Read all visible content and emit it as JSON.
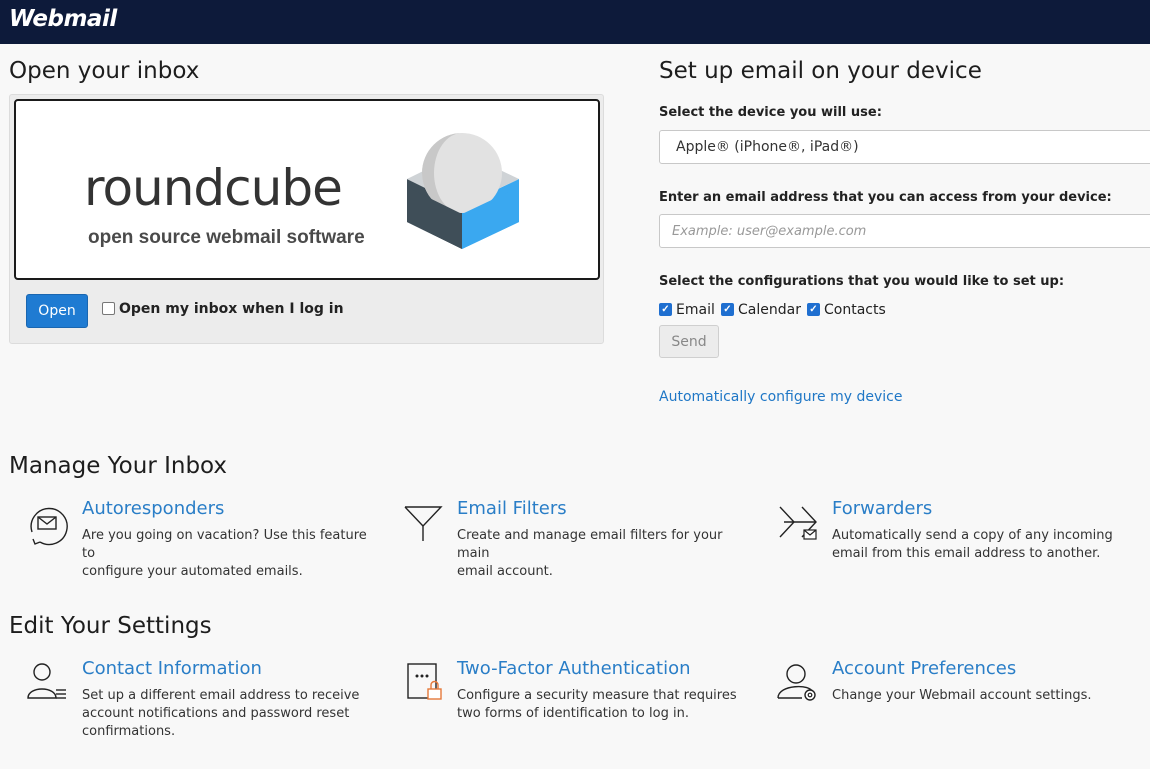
{
  "header": {
    "brand": "Webmail"
  },
  "open_inbox": {
    "title": "Open your inbox",
    "logo_wordmark": "roundcube",
    "logo_tagline": "open source webmail software",
    "open_button": "Open",
    "open_on_login_label": "Open my inbox when I log in",
    "open_on_login_checked": false
  },
  "device_setup": {
    "title": "Set up email on your device",
    "device_label": "Select the device you will use:",
    "device_value": "Apple® (iPhone®, iPad®)",
    "email_label": "Enter an email address that you can access from your device:",
    "email_placeholder": "Example: user@example.com",
    "config_label": "Select the configurations that you would like to set up:",
    "configs": [
      {
        "label": "Email",
        "checked": true
      },
      {
        "label": "Calendar",
        "checked": true
      },
      {
        "label": "Contacts",
        "checked": true
      }
    ],
    "send_button": "Send",
    "auto_config_link": "Automatically configure my device"
  },
  "manage": {
    "title": "Manage Your Inbox",
    "items": [
      {
        "title": "Autoresponders",
        "desc_line1": "Are you going on vacation? Use this feature to",
        "desc_line2": "configure your automated emails.",
        "icon": "autoresponder-icon"
      },
      {
        "title": "Email Filters",
        "desc_line1": "Create and manage email filters for your main",
        "desc_line2": "email account.",
        "icon": "filter-funnel-icon"
      },
      {
        "title": "Forwarders",
        "desc_line1": "Automatically send a copy of any incoming",
        "desc_line2": "email from this email address to another.",
        "icon": "forwarder-arrow-icon"
      }
    ]
  },
  "settings": {
    "title": "Edit Your Settings",
    "items": [
      {
        "title": "Contact Information",
        "desc_line1": "Set up a different email address to receive",
        "desc_line2": "account notifications and password reset",
        "desc_line3": "confirmations.",
        "icon": "contact-person-icon"
      },
      {
        "title": "Two-Factor Authentication",
        "desc_line1": "Configure a security measure that requires",
        "desc_line2": "two forms of identification to log in.",
        "desc_line3": "",
        "icon": "two-factor-lock-icon"
      },
      {
        "title": "Account Preferences",
        "desc_line1": "Change your Webmail account settings.",
        "desc_line2": "",
        "desc_line3": "",
        "icon": "user-gear-icon"
      }
    ]
  },
  "colors": {
    "header_bg": "#0d1a3a",
    "link": "#1f77c6",
    "primary_button": "#1f7bd2",
    "cube_blue": "#3aa8f0",
    "cube_dark": "#3f4e58"
  }
}
